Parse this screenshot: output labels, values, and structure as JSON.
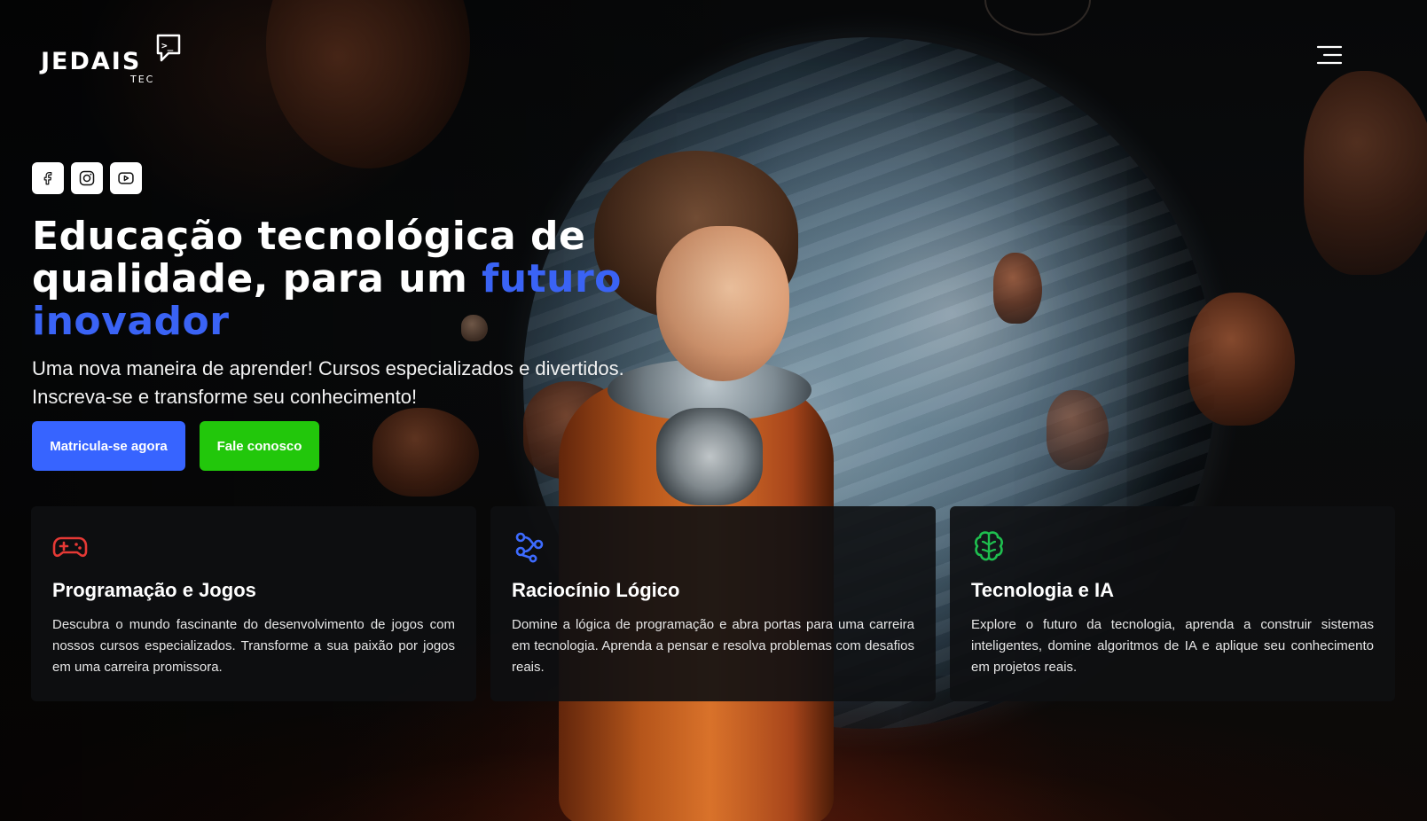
{
  "brand": {
    "name": "JEDAIS",
    "sub": "TEC",
    "prompt_glyph": ">_"
  },
  "header": {
    "menu_icon": "hamburger-icon"
  },
  "socials": [
    {
      "name": "facebook",
      "icon": "facebook-icon"
    },
    {
      "name": "instagram",
      "icon": "instagram-icon"
    },
    {
      "name": "youtube",
      "icon": "youtube-icon"
    }
  ],
  "hero": {
    "title_part1": "Educação tecnológica de qualidade, para um ",
    "title_accent": "futuro inovador",
    "subtitle": "Uma nova maneira de aprender! Cursos especializados e divertidos. Inscreva-se e transforme seu conhecimento!",
    "primary_button": "Matricula-se agora",
    "secondary_button": "Fale conosco"
  },
  "cards": [
    {
      "icon": "gamepad-icon",
      "title": "Programação e Jogos",
      "text": "Descubra o mundo fascinante do desenvolvimento de jogos com nossos cursos especializados. Transforme a sua paixão por jogos em uma carreira promissora."
    },
    {
      "icon": "logic-nodes-icon",
      "title": "Raciocínio Lógico",
      "text": "Domine a lógica de programação e abra portas para uma carreira em tecnologia. Aprenda a pensar e resolva problemas com desafios reais."
    },
    {
      "icon": "brain-icon",
      "title": "Tecnologia e IA",
      "text": "Explore o futuro da tecnologia, aprenda a construir sistemas inteligentes, domine algoritmos de IA e aplique seu conhecimento em projetos reais."
    }
  ],
  "colors": {
    "accent_blue": "#3a63f5",
    "button_blue": "#3764ff",
    "button_green": "#22c70b",
    "icon_red": "#e53935",
    "icon_blue": "#3d6bff",
    "icon_green": "#1fbf4f",
    "card_bg": "#0e1012"
  }
}
